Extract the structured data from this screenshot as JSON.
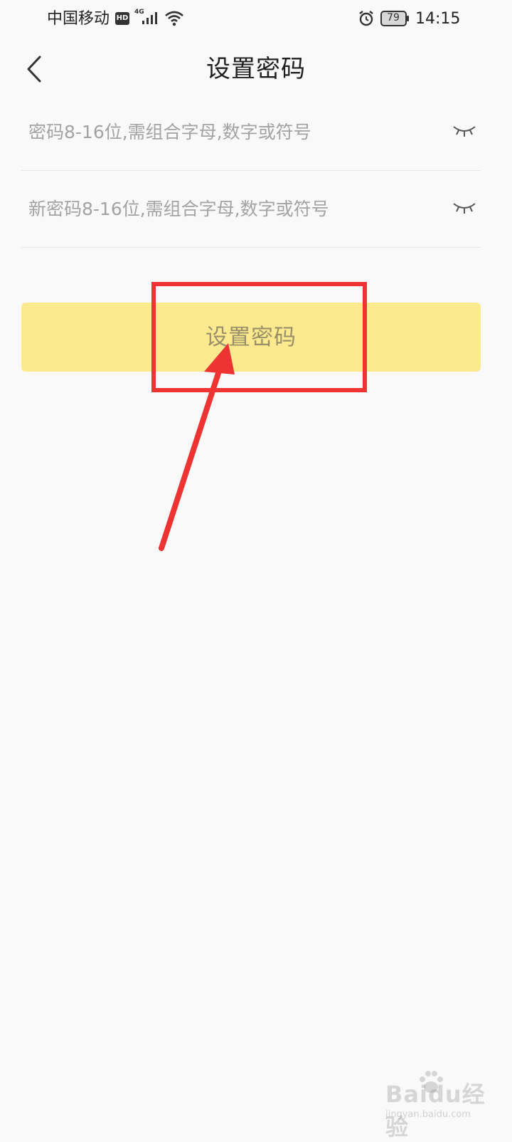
{
  "status_bar": {
    "carrier": "中国移动",
    "hd_badge": "HD",
    "network_type": "4G",
    "battery_level": "79",
    "time": "14:15",
    "icons": [
      "signal-icon",
      "wifi-icon",
      "alarm-icon",
      "battery-icon"
    ]
  },
  "header": {
    "back_icon": "chevron-left-icon",
    "title": "设置密码"
  },
  "form": {
    "password_placeholder": "密码8-16位,需组合字母,数字或符号",
    "new_password_placeholder": "新密码8-16位,需组合字母,数字或符号",
    "toggle_icon": "eye-closed-icon",
    "submit_label": "设置密码",
    "submit_color": "#fde98e"
  },
  "annotation": {
    "color": "#ee3333"
  },
  "watermark": {
    "text": "Baidu经验",
    "sub": "jingyan.baidu.com"
  }
}
